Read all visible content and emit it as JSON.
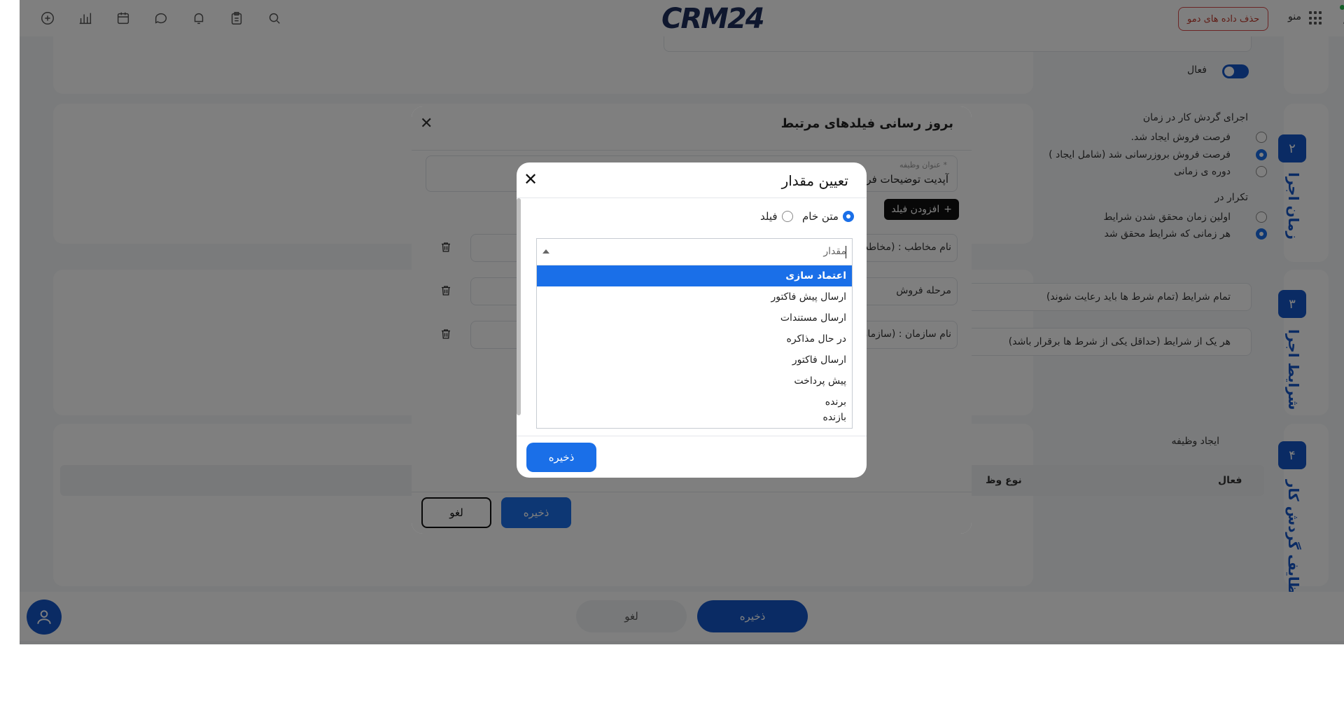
{
  "header": {
    "logo_text": "CRM",
    "logo_num": "24",
    "demo_button": "حذف داده های دمو",
    "menu_label": "منو"
  },
  "page": {
    "active_label": "فعال",
    "step2": {
      "number": "۲",
      "title": "زمان اجرا",
      "heading": "اجرای گردش کار در زمان",
      "options": [
        "فرصت فروش ایجاد شد.",
        "فرصت فروش بروزرسانی شد (شامل ایجاد )",
        "دوره ی زمانی"
      ],
      "repeat_heading": "تکرار در",
      "repeat_options": [
        "اولین زمان محقق شدن شرایط",
        "هر زمانی که شرایط محقق شد"
      ]
    },
    "step3": {
      "number": "۳",
      "title": "شرایط اجرا",
      "all_conditions": "تمام شرایط (تمام شرط ها باید رعایت شوند)",
      "any_conditions": "هر یک از شرایط (حداقل یکی از شرط ها برقرار باشد)"
    },
    "step4": {
      "number": "۴",
      "title": "وظایف گردش کار",
      "create_task": "ایجاد وظیفه",
      "col_active": "فعال",
      "col_task_type": "نوع وظ"
    },
    "bottom_save": "ذخیره",
    "bottom_cancel": "لغو"
  },
  "modal1": {
    "title": "بروز رسانی فیلدهای مرتبط",
    "task_title_label": "عنوان وظیفه *",
    "task_title_value": "آپدیت توضیحات فر",
    "add_field": "افزودن فیلد",
    "rows": [
      "نام مخاطب : (مخاطب",
      "مرحله فروش",
      "نام سازمان : (سازمان"
    ],
    "save": "ذخیره",
    "cancel": "لغو"
  },
  "modal2": {
    "title": "تعیین مقدار",
    "radio_raw": "متن خام",
    "radio_field": "فیلد",
    "placeholder": "مقدار",
    "options": [
      "اعتماد سازی",
      "ارسال پیش فاکتور",
      "ارسال مستندات",
      "در حال مذاکره",
      "ارسال فاکتور",
      "پیش پرداخت",
      "برنده",
      "بازنده"
    ],
    "selected_index": 0,
    "save": "ذخیره"
  },
  "colors": {
    "primary": "#1a6fe8",
    "step_blue": "#1456c8",
    "demo_red": "#c0392b"
  }
}
